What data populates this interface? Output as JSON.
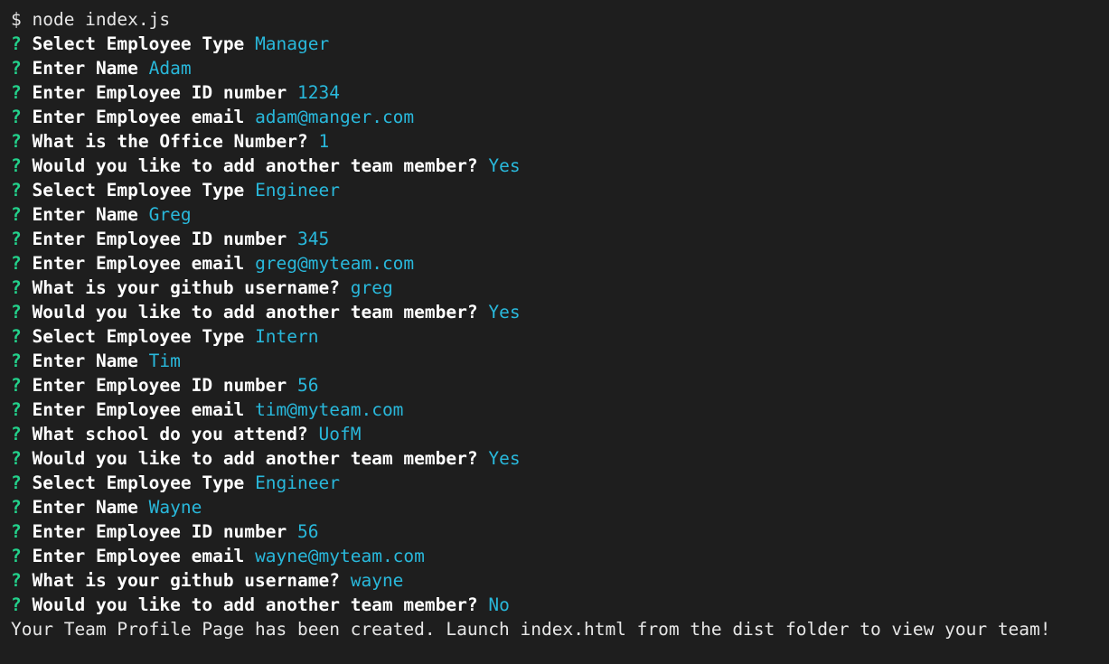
{
  "terminal": {
    "command_line": "$ node index.js",
    "prompt_symbol": "?",
    "qa": [
      {
        "q": "Select Employee Type",
        "a": "Manager"
      },
      {
        "q": "Enter Name",
        "a": "Adam"
      },
      {
        "q": "Enter Employee ID number",
        "a": "1234"
      },
      {
        "q": "Enter Employee email",
        "a": "adam@manger.com"
      },
      {
        "q": "What is the Office Number?",
        "a": "1"
      },
      {
        "q": "Would you like to add another team member?",
        "a": "Yes"
      },
      {
        "q": "Select Employee Type",
        "a": "Engineer"
      },
      {
        "q": "Enter Name",
        "a": "Greg"
      },
      {
        "q": "Enter Employee ID number",
        "a": "345"
      },
      {
        "q": "Enter Employee email",
        "a": "greg@myteam.com"
      },
      {
        "q": "What is your github username?",
        "a": "greg"
      },
      {
        "q": "Would you like to add another team member?",
        "a": "Yes"
      },
      {
        "q": "Select Employee Type",
        "a": "Intern"
      },
      {
        "q": "Enter Name",
        "a": "Tim"
      },
      {
        "q": "Enter Employee ID number",
        "a": "56"
      },
      {
        "q": "Enter Employee email",
        "a": "tim@myteam.com"
      },
      {
        "q": "What school do you attend?",
        "a": "UofM"
      },
      {
        "q": "Would you like to add another team member?",
        "a": "Yes"
      },
      {
        "q": "Select Employee Type",
        "a": "Engineer"
      },
      {
        "q": "Enter Name",
        "a": "Wayne"
      },
      {
        "q": "Enter Employee ID number",
        "a": "56"
      },
      {
        "q": "Enter Employee email",
        "a": "wayne@myteam.com"
      },
      {
        "q": "What is your github username?",
        "a": "wayne"
      },
      {
        "q": "Would you like to add another team member?",
        "a": "No"
      }
    ],
    "final_message": "Your Team Profile Page has been created. Launch index.html from the dist folder to view your team!"
  },
  "colors": {
    "background": "#1e1e1e",
    "prompt_mark": "#23d18b",
    "question": "#ffffff",
    "answer": "#29b8db",
    "plain": "#e6e6e6"
  }
}
